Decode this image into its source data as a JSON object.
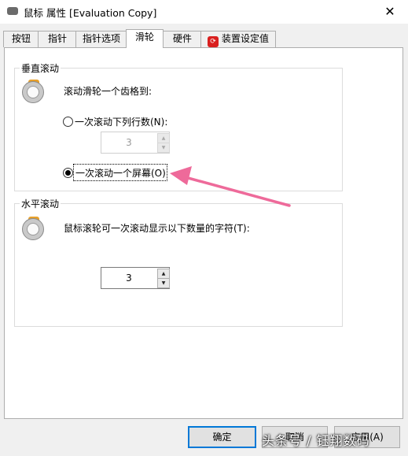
{
  "window": {
    "title": "鼠标 属性 [Evaluation Copy]",
    "close_glyph": "✕"
  },
  "tabs": [
    {
      "label": "按钮"
    },
    {
      "label": "指针"
    },
    {
      "label": "指针选项"
    },
    {
      "label": "滑轮",
      "active": true
    },
    {
      "label": "硬件"
    },
    {
      "label": "装置设定值",
      "badge": "⟳"
    }
  ],
  "vertical_scroll": {
    "title": "垂直滚动",
    "description": "滚动滑轮一个齿格到:",
    "option_lines": {
      "label": "一次滚动下列行数(N):",
      "selected": false
    },
    "lines_value": "3",
    "option_screen": {
      "label": "一次滚动一个屏幕(O)",
      "selected": true
    }
  },
  "horizontal_scroll": {
    "title": "水平滚动",
    "description": "鼠标滚轮可一次滚动显示以下数量的字符(T):",
    "chars_value": "3"
  },
  "buttons": {
    "ok": "确定",
    "cancel": "取消",
    "apply": "应用(A)"
  },
  "annotation_arrow_color": "#ee6a9a",
  "watermark": "头条号 / 钰翔数码"
}
